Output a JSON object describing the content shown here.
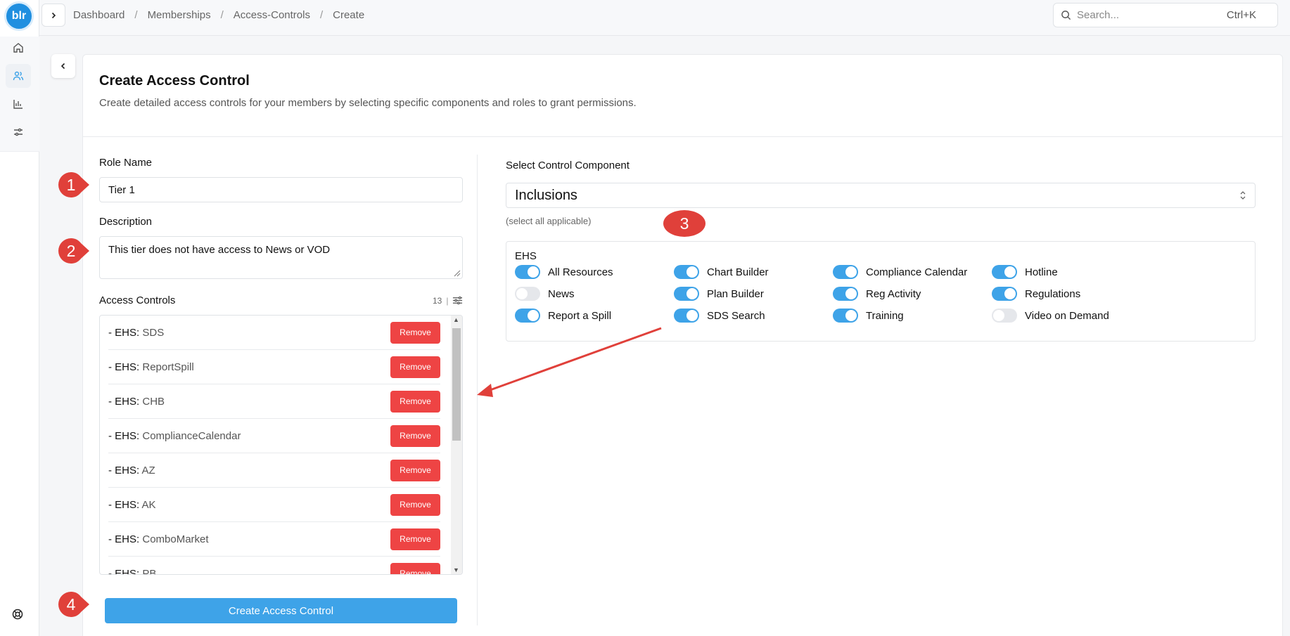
{
  "app": {
    "logo_text": "blr"
  },
  "breadcrumb": [
    "Dashboard",
    "Memberships",
    "Access-Controls",
    "Create"
  ],
  "search": {
    "placeholder": "Search...",
    "shortcut": "Ctrl+K"
  },
  "header": {
    "title": "Create Access Control",
    "subtitle": "Create detailed access controls for your members by selecting specific components and roles to grant permissions."
  },
  "form": {
    "role_name_label": "Role Name",
    "role_name_value": "Tier 1",
    "description_label": "Description",
    "description_value": "This tier does not have access to News or VOD",
    "access_controls_label": "Access Controls",
    "access_controls_count": "13",
    "remove_label": "Remove",
    "items": [
      {
        "prefix": "- EHS:",
        "value": "SDS"
      },
      {
        "prefix": "- EHS:",
        "value": "ReportSpill"
      },
      {
        "prefix": "- EHS:",
        "value": "CHB"
      },
      {
        "prefix": "- EHS:",
        "value": "ComplianceCalendar"
      },
      {
        "prefix": "- EHS:",
        "value": "AZ"
      },
      {
        "prefix": "- EHS:",
        "value": "AK"
      },
      {
        "prefix": "- EHS:",
        "value": "ComboMarket"
      },
      {
        "prefix": "- EHS:",
        "value": "PB"
      }
    ],
    "submit_label": "Create Access Control"
  },
  "component": {
    "label": "Select Control Component",
    "selected": "Inclusions",
    "hint": "(select all applicable)",
    "group": "EHS",
    "toggles": [
      {
        "label": "All Resources",
        "on": true
      },
      {
        "label": "Chart Builder",
        "on": true
      },
      {
        "label": "Compliance Calendar",
        "on": true
      },
      {
        "label": "Hotline",
        "on": true
      },
      {
        "label": "News",
        "on": false
      },
      {
        "label": "Plan Builder",
        "on": true
      },
      {
        "label": "Reg Activity",
        "on": true
      },
      {
        "label": "Regulations",
        "on": true
      },
      {
        "label": "Report a Spill",
        "on": true
      },
      {
        "label": "SDS Search",
        "on": true
      },
      {
        "label": "Training",
        "on": true
      },
      {
        "label": "Video on Demand",
        "on": false
      }
    ]
  },
  "callouts": [
    "1",
    "2",
    "3",
    "4"
  ],
  "colors": {
    "accent": "#3ea3e8",
    "danger": "#ee4444",
    "callout": "#e0403a"
  }
}
